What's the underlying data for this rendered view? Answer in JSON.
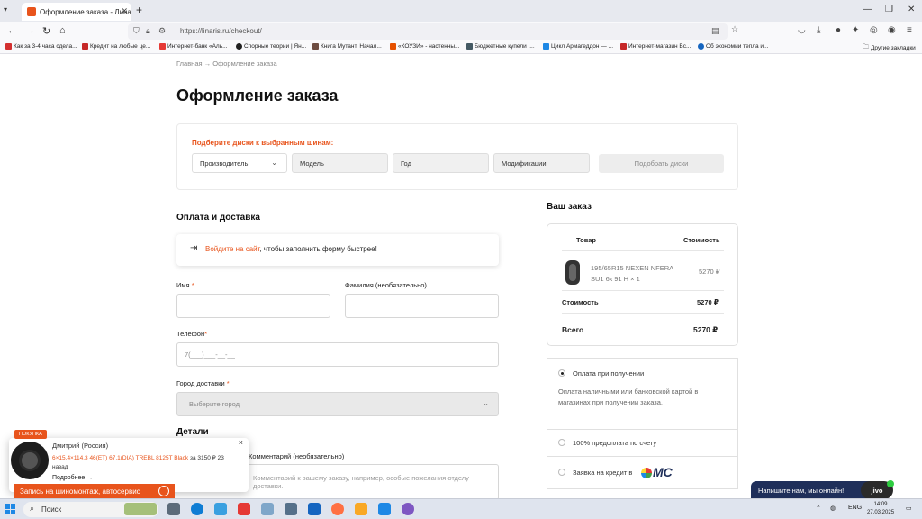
{
  "browser": {
    "tab_title": "Оформление заказа - Линарис",
    "url": "https://linaris.ru/checkout/",
    "bookmarks": [
      {
        "label": "Как за 3-4 часа сдела...",
        "color": "#d32f2f"
      },
      {
        "label": "Кредит на любые це...",
        "color": "#c62828"
      },
      {
        "label": "Интернет-банк «Аль...",
        "color": "#e53935"
      },
      {
        "label": "Спорные теории | Ян...",
        "color": "#212121"
      },
      {
        "label": "Книга Мутант. Начал...",
        "color": "#6d4c41"
      },
      {
        "label": "«КОУЗИ» - настенны...",
        "color": "#e65100"
      },
      {
        "label": "Бюджетные купели |...",
        "color": "#455a64"
      },
      {
        "label": "Цикл Армагеддон — ...",
        "color": "#1e88e5"
      },
      {
        "label": "Интернет-магазин Вс...",
        "color": "#c62828"
      },
      {
        "label": "Об экономии тепла и...",
        "color": "#1565c0"
      }
    ],
    "other_bookmarks": "Другие закладки"
  },
  "page": {
    "breadcrumb": {
      "home": "Главная",
      "sep": "→",
      "current": "Оформление заказа"
    },
    "title": "Оформление заказа",
    "disk_picker": {
      "title": "Подберите диски к выбранным шинам:",
      "manufacturer": "Производитель",
      "model": "Модель",
      "year": "Год",
      "modification": "Модификации",
      "button": "Подобрать диски"
    },
    "payment_delivery": {
      "title": "Оплата и доставка",
      "login_link": "Войдите на сайт",
      "login_rest": ", чтобы заполнить форму быстрее!"
    },
    "form": {
      "name_label": "Имя",
      "surname_label": "Фамилия (необязательно)",
      "phone_label": "Телефон",
      "phone_placeholder": "7(___)___-__-__",
      "city_label": "Город доставки",
      "city_placeholder": "Выберите город",
      "required_mark": "*"
    },
    "details": {
      "title": "Детали",
      "comment_label": "Комментарий (необязательно)",
      "comment_placeholder": "Комментарий к вашему заказу, например, особые пожелания отделу доставки."
    },
    "order": {
      "title": "Ваш заказ",
      "col_product": "Товар",
      "col_cost": "Стоимость",
      "item_name": "195/65R15 NEXEN NFERA SU1 6к 91 H",
      "item_qty": "× 1",
      "item_price": "5270 ₽",
      "subtotal_label": "Стоимость",
      "subtotal_value": "5270 ₽",
      "total_label": "Всего",
      "total_value": "5270 ₽"
    },
    "payment": {
      "option1": "Оплата при получении",
      "option1_desc": "Оплата наличными или банковской картой в магазинах при получении заказа.",
      "option2": "100% предоплата по счету",
      "option3": "Заявка на кредит в",
      "credit_brand": "МС",
      "selected": "option1"
    }
  },
  "popup": {
    "badge": "ПОКУПКА",
    "name": "Дмитрий (Россия)",
    "product": "6×15.4×114.3 46(ET) 67.1(DIA) TREBL 8125T Black",
    "price_text": "за 3150 ₽ 23 назад",
    "more": "Подробнее →",
    "service": "Запись на шиномонтаж, автосервис"
  },
  "chat": {
    "text": "Напишите нам, мы онлайн!",
    "brand": "jivo"
  },
  "taskbar": {
    "search": "Поиск",
    "lang": "ENG",
    "time": "14:09",
    "date": "27.03.2025"
  }
}
